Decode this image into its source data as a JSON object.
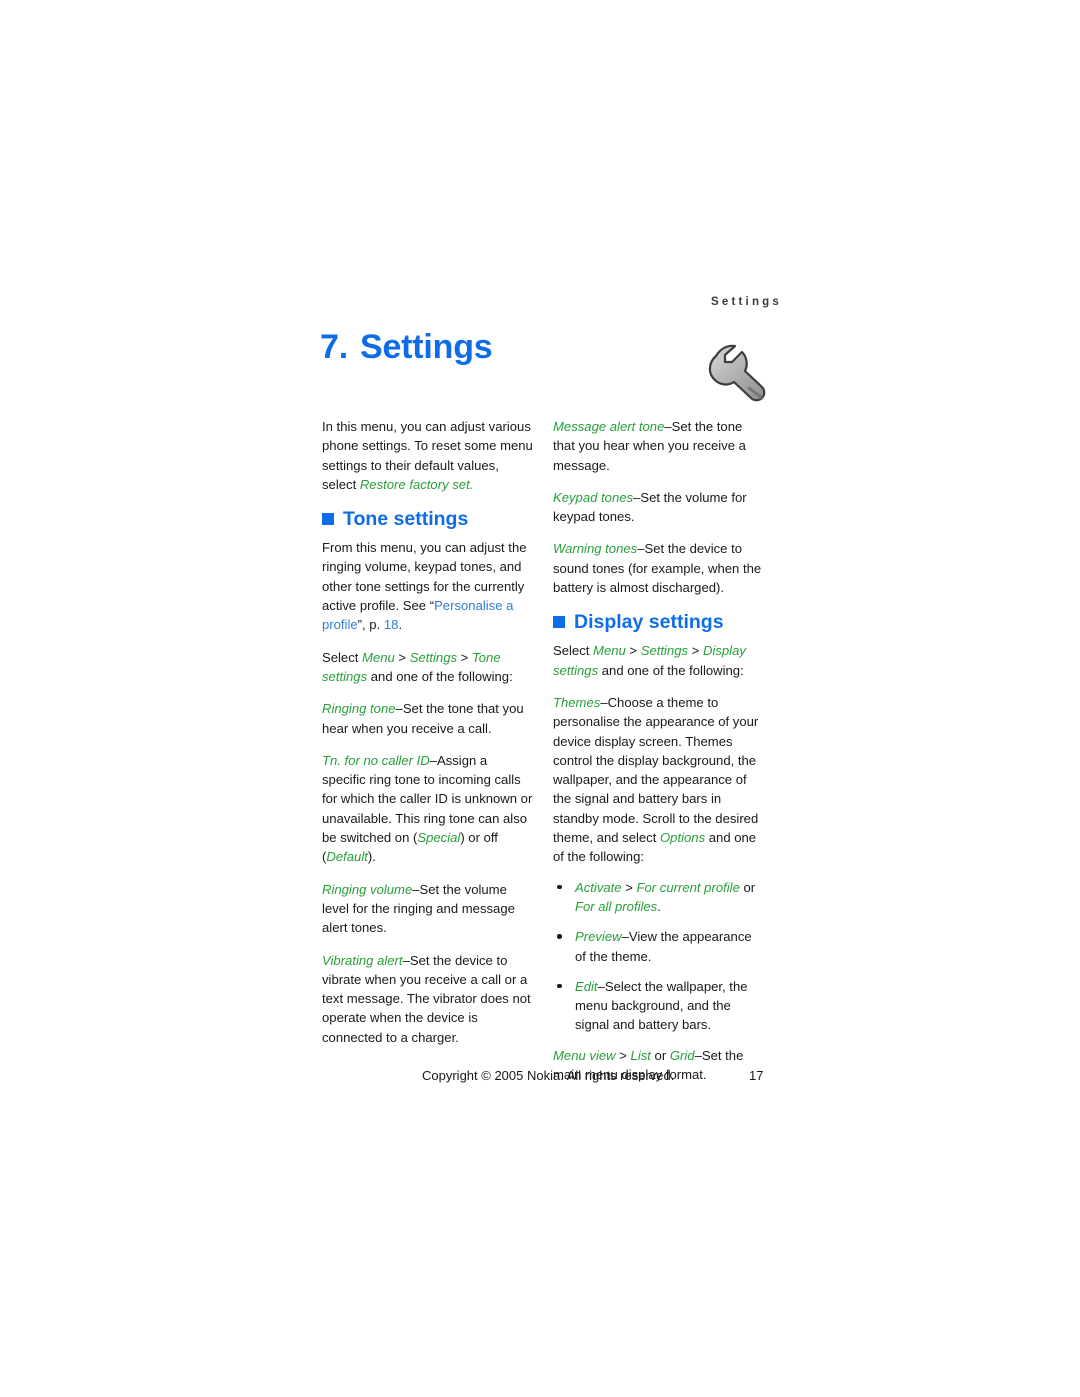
{
  "header": {
    "running_head": "Settings",
    "chapter_number": "7.",
    "chapter_title": "Settings",
    "icon": "wrench-icon"
  },
  "colors": {
    "heading_blue": "#0f6ce8",
    "link_blue": "#2f7ed8",
    "ui_term_green": "#27a03a",
    "body_text": "#1a1a1a"
  },
  "left_column": {
    "intro": {
      "text_1": "In this menu, you can adjust various phone settings. To reset some menu settings to their default values, select ",
      "term_restore": "Restore factory set."
    },
    "tone_settings_heading": "Tone settings",
    "tone_intro": {
      "text_1": "From this menu, you can adjust the ringing volume, keypad tones, and other tone settings for the currently active profile. See “",
      "link_personalise": "Personalise a profile",
      "text_2": "”, p. ",
      "link_page": "18",
      "text_3": "."
    },
    "tone_path": {
      "text_1": "Select ",
      "menu": "Menu",
      "sep_1": " > ",
      "settings": "Settings",
      "sep_2": " > ",
      "tone_settings": "Tone settings",
      "text_2": " and one of the following:"
    },
    "items": [
      {
        "term": "Ringing tone",
        "desc": "–Set the tone that you hear when you receive a call."
      },
      {
        "term": "Tn. for no caller ID",
        "desc_1": "–Assign a specific ring tone to incoming calls for which the caller ID is unknown or unavailable. This ring tone can also be switched on (",
        "opt_1": "Special",
        "desc_2": ") or off (",
        "opt_2": "Default",
        "desc_3": ")."
      },
      {
        "term": "Ringing volume",
        "desc": "–Set the volume level for the ringing and message alert tones."
      },
      {
        "term": "Vibrating alert",
        "desc": "–Set the device to vibrate when you receive a call or a text message. The vibrator does not operate when the device is connected to a charger."
      }
    ]
  },
  "right_column": {
    "tone_items": [
      {
        "term": "Message alert tone",
        "desc": "–Set the tone that you hear when you receive a message."
      },
      {
        "term": "Keypad tones",
        "desc": "–Set the volume for keypad tones."
      },
      {
        "term": "Warning tones",
        "desc": "–Set the device to sound tones (for example, when the battery is almost discharged)."
      }
    ],
    "display_settings_heading": "Display settings",
    "display_path": {
      "text_1": "Select ",
      "menu": "Menu",
      "sep_1": " > ",
      "settings": "Settings",
      "sep_2": " > ",
      "display_settings": "Display settings",
      "text_2": " and one of the following:"
    },
    "themes": {
      "term": "Themes",
      "desc_1": "–Choose a theme to personalise the appearance of your device display screen. Themes control the display background, the wallpaper, and the appearance of the signal and battery bars in standby mode. Scroll to the desired theme, and select ",
      "options": "Options",
      "desc_2": " and one of the following:"
    },
    "theme_bullets": [
      {
        "term_1": "Activate",
        "sep": " > ",
        "term_2": "For current profile",
        "mid": " or ",
        "term_3": "For all profiles",
        "end": "."
      },
      {
        "term_1": "Preview",
        "desc": "–View the appearance of the theme."
      },
      {
        "term_1": "Edit",
        "desc": "–Select the wallpaper, the menu background, and the signal and battery bars."
      }
    ],
    "menu_view": {
      "term_1": "Menu view",
      "sep": " > ",
      "term_2": "List",
      "mid": " or ",
      "term_3": "Grid",
      "desc": "–Set the main menu display format."
    }
  },
  "footer": {
    "copyright": "Copyright © 2005 Nokia. All rights reserved.",
    "page_number": "17"
  }
}
